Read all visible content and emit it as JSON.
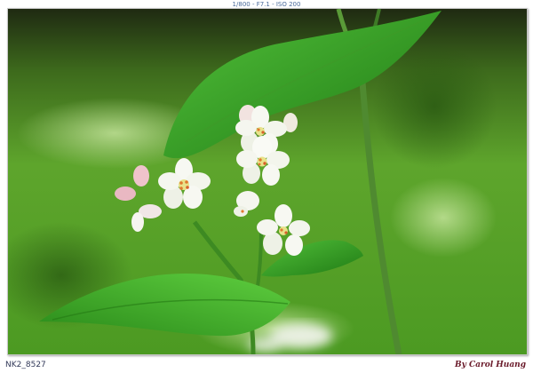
{
  "exif_caption": "1/800 - F7.1 - ISO 200",
  "file_name": "NK2_8527",
  "signature": "By Carol Huang",
  "colors": {
    "background_green": "#5aa22a",
    "leaf_green": "#2f9a1e",
    "petal_white": "#f7f8f2",
    "bud_pink": "#e9b8c2",
    "stamen_orange": "#e07a30"
  }
}
